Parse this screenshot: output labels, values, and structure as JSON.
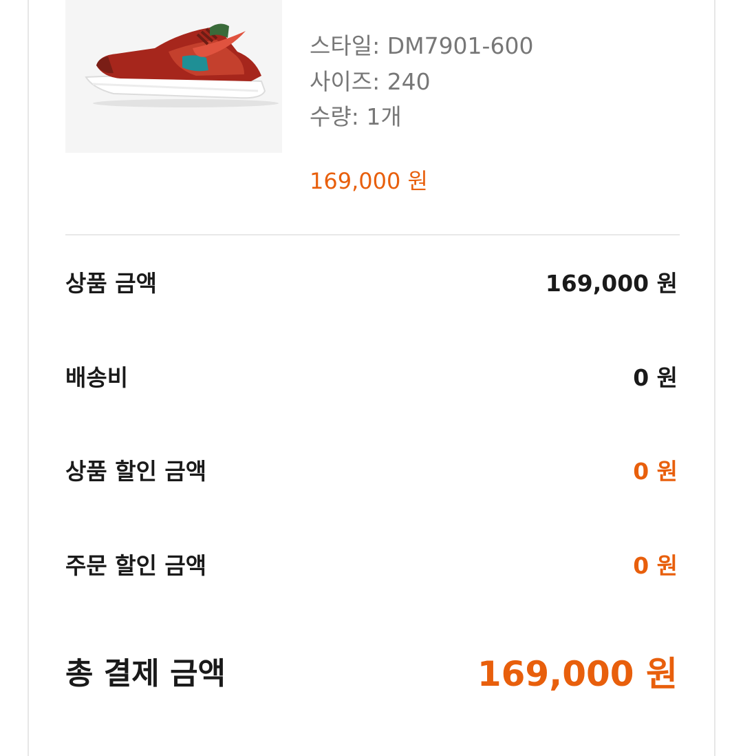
{
  "product": {
    "image_alt": "sneaker-product-image",
    "style_label": "스타일: DM7901-600",
    "size_label": "사이즈: 240",
    "quantity_label": "수량: 1개",
    "price": "169,000 원"
  },
  "summary": {
    "product_amount_label": "상품 금액",
    "product_amount_value": "169,000 원",
    "shipping_label": "배송비",
    "shipping_value": "0 원",
    "product_discount_label": "상품 할인 금액",
    "product_discount_value": "0 원",
    "order_discount_label": "주문 할인 금액",
    "order_discount_value": "0 원",
    "total_label": "총 결제 금액",
    "total_value": "169,000 원"
  },
  "colors": {
    "accent": "#e85f0c",
    "text": "#1a1a1a",
    "muted": "#777777"
  }
}
